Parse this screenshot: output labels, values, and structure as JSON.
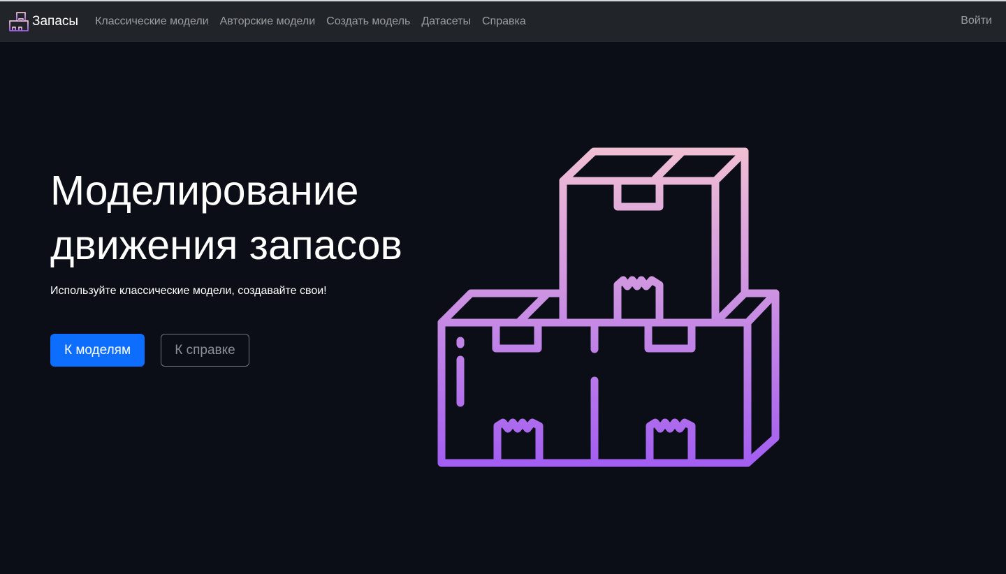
{
  "navbar": {
    "brand": "Запасы",
    "links": [
      {
        "label": "Классические модели"
      },
      {
        "label": "Авторские модели"
      },
      {
        "label": "Создать модель"
      },
      {
        "label": "Датасеты"
      },
      {
        "label": "Справка"
      }
    ],
    "login": "Войти"
  },
  "hero": {
    "title_line1": "Моделирование",
    "title_line2": "движения запасов",
    "subtitle": "Используйте классические модели, создавайте свои!",
    "primary_button": "К моделям",
    "secondary_button": "К справке",
    "illustration": "stacked-boxes-icon"
  },
  "colors": {
    "background": "#0b0e17",
    "navbar": "#212529",
    "primary": "#0d6efd",
    "gradient_top": "#f0bfd4",
    "gradient_bottom": "#a35ef2"
  }
}
